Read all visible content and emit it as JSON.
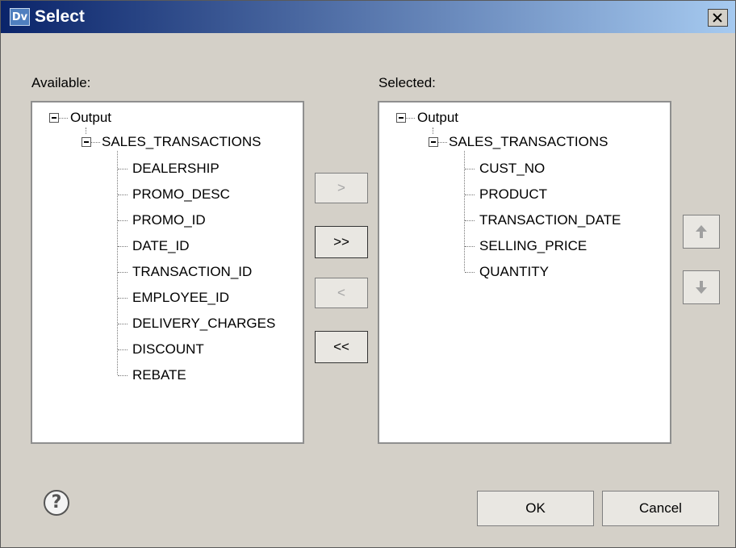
{
  "window": {
    "title": "Select",
    "icon_text": "Dv"
  },
  "available": {
    "label": "Available:",
    "root": "Output",
    "table": "SALES_TRANSACTIONS",
    "fields": [
      "DEALERSHIP",
      "PROMO_DESC",
      "PROMO_ID",
      "DATE_ID",
      "TRANSACTION_ID",
      "EMPLOYEE_ID",
      "DELIVERY_CHARGES",
      "DISCOUNT",
      "REBATE"
    ]
  },
  "selected": {
    "label": "Selected:",
    "root": "Output",
    "table": "SALES_TRANSACTIONS",
    "fields": [
      "CUST_NO",
      "PRODUCT",
      "TRANSACTION_DATE",
      "SELLING_PRICE",
      "QUANTITY"
    ]
  },
  "transfer": {
    "add": ">",
    "add_all": ">>",
    "remove": "<",
    "remove_all": "<<"
  },
  "footer": {
    "ok": "OK",
    "cancel": "Cancel",
    "help_glyph": "?"
  },
  "icons": [
    "help-icon",
    "close-icon",
    "arrow-up-icon",
    "arrow-down-icon",
    "app-icon"
  ]
}
